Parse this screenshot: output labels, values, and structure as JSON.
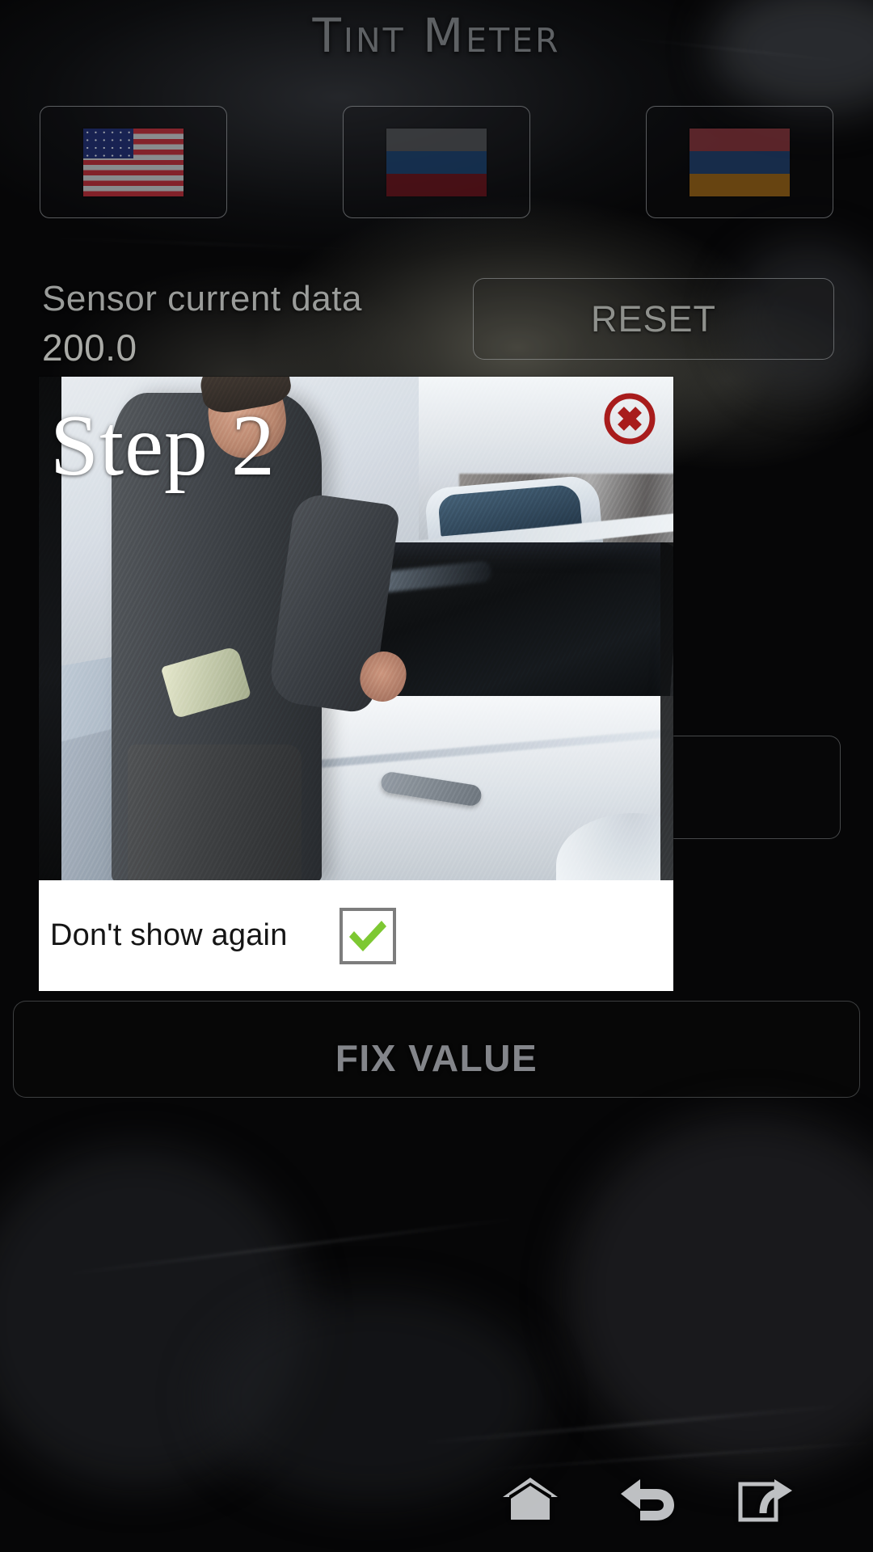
{
  "app": {
    "title": "Tint Meter"
  },
  "language_buttons": [
    {
      "name": "flag-us",
      "label": "United States flag"
    },
    {
      "name": "flag-ru",
      "label": "Russia flag"
    },
    {
      "name": "flag-am",
      "label": "Armenia flag"
    }
  ],
  "sensor": {
    "label": "Sensor current data",
    "value": "200.0"
  },
  "actions": {
    "reset_label": "RESET",
    "fix_value_label": "FIX VALUE"
  },
  "dialog": {
    "step_label": "Step 2",
    "close_icon": "close-circle-icon",
    "dont_show_again_label": "Don't show again",
    "dont_show_again_checked": true,
    "image_alt": "Officer measuring window tint on a car door"
  },
  "navbar": {
    "items": [
      {
        "name": "home-icon",
        "label": "Home"
      },
      {
        "name": "back-icon",
        "label": "Back"
      },
      {
        "name": "recents-icon",
        "label": "Recents"
      }
    ]
  },
  "colors": {
    "title_text": "#5e6164",
    "muted_text": "#9a9c9a",
    "dialog_bg": "#ffffff",
    "close_red": "#a81c1c",
    "check_green": "#7dc832"
  }
}
